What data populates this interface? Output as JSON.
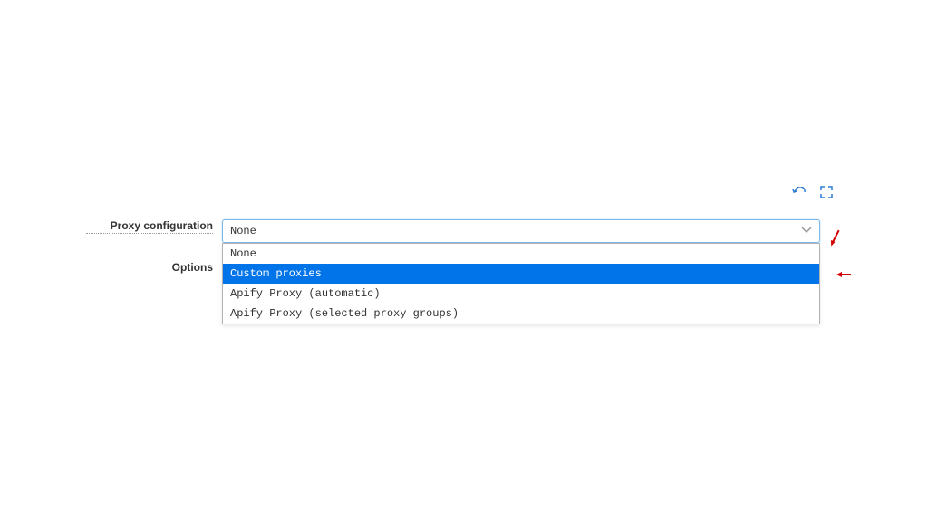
{
  "labels": {
    "proxyConfiguration": "Proxy configuration",
    "options": "Options"
  },
  "proxySelect": {
    "selected": "None",
    "options": [
      "None",
      "Custom proxies",
      "Apify Proxy (automatic)",
      "Apify Proxy (selected proxy groups)"
    ],
    "highlightedIndex": 1
  }
}
